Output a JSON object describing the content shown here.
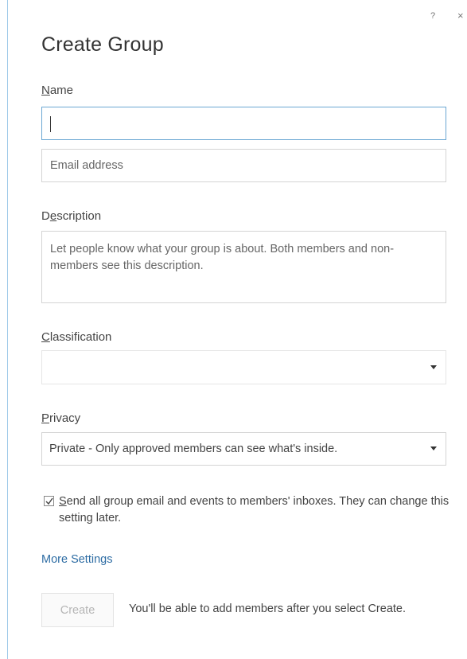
{
  "dialog": {
    "title": "Create Group",
    "help_glyph": "?",
    "close_glyph": "×"
  },
  "name": {
    "label_access": "N",
    "label_rest": "ame",
    "value": ""
  },
  "email": {
    "placeholder": "Email address"
  },
  "description": {
    "label_pre": "D",
    "label_access": "e",
    "label_rest": "scription",
    "placeholder": "Let people know what your group is about. Both members and non-members see this description."
  },
  "classification": {
    "label_access": "C",
    "label_rest": "lassification",
    "selected": ""
  },
  "privacy": {
    "label_access": "P",
    "label_rest": "rivacy",
    "selected": "Private - Only approved members can see what's inside."
  },
  "subscribe": {
    "checked": true,
    "label_access": "S",
    "label_rest": "end all group email and events to members' inboxes. They can change this setting later."
  },
  "more_settings": "More Settings",
  "footer": {
    "create_label": "Create",
    "hint": "You'll be able to add members after you select Create."
  }
}
